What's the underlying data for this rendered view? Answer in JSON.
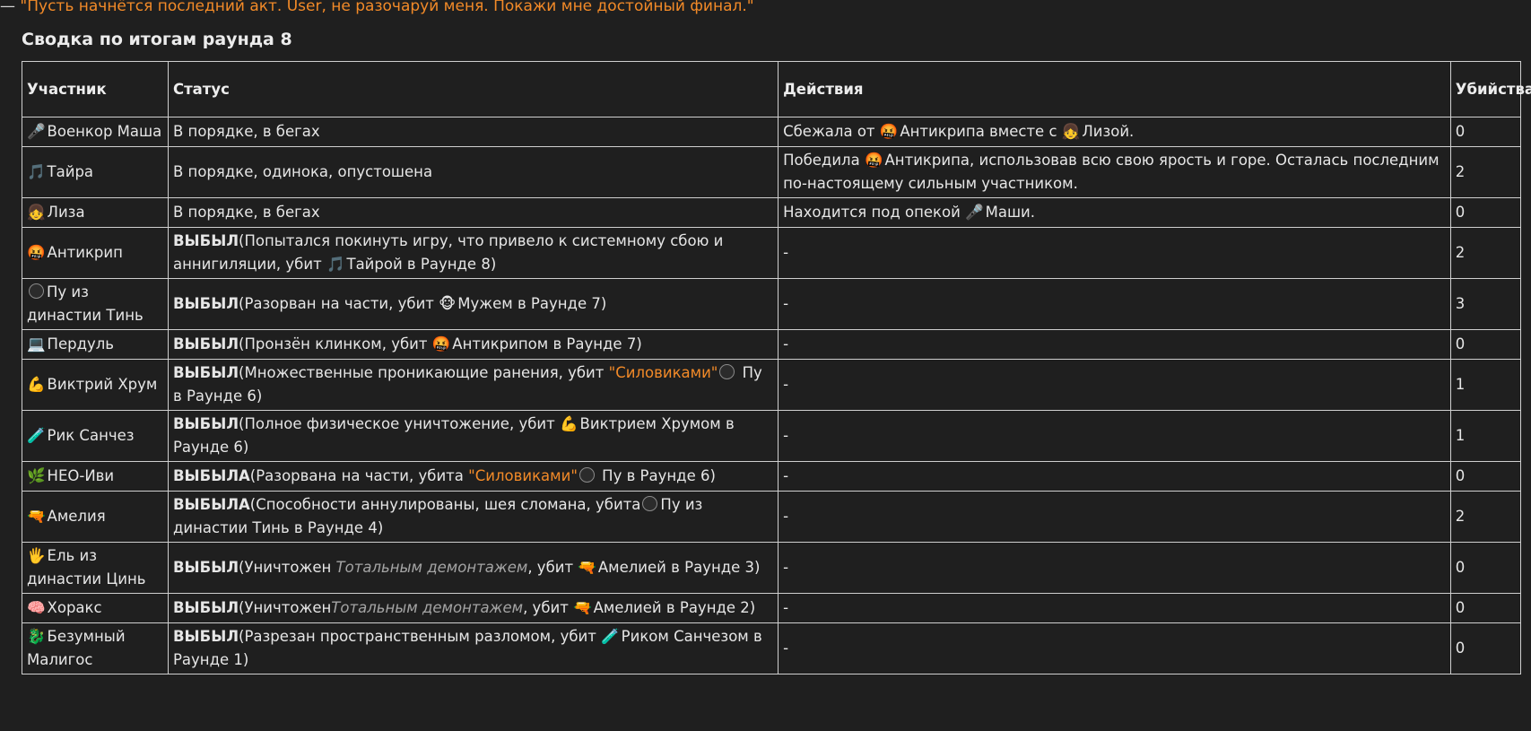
{
  "intro": {
    "dash": "—",
    "quote": "\"Пусть начнётся последний акт. User, не разочаруй меня. Покажи мне достойный финал.\""
  },
  "heading": "Сводка по итогам раунда 8",
  "table": {
    "headers": {
      "participant": "Участник",
      "status": "Статус",
      "actions": "Действия",
      "kills": "Убийства"
    },
    "rows": [
      {
        "emoji": "🎤",
        "name": "Военкор Маша",
        "status": {
          "plain": "В порядке, в бегах"
        },
        "actions": {
          "parts": [
            "Сбежала от",
            "🤬",
            "Антикрипа вместе с",
            "👧",
            "Лизой."
          ]
        },
        "kills": "0"
      },
      {
        "emoji": "🎵",
        "name": "Тайра",
        "status": {
          "plain": "В порядке, одинока, опустошена"
        },
        "actions": {
          "parts": [
            "Победила",
            "🤬",
            "Антикрипа, использовав всю свою ярость и горе. Осталась последним по-настоящему сильным участником."
          ]
        },
        "kills": "2"
      },
      {
        "emoji": "👧",
        "name": "Лиза",
        "status": {
          "plain": "В порядке, в бегах"
        },
        "actions": {
          "parts": [
            "Находится под опекой",
            "🎤",
            "Маши."
          ]
        },
        "kills": "0"
      },
      {
        "emoji": "🤬",
        "name": "Антикрип",
        "status": {
          "bold": "ВЫБЫЛ",
          "parts": [
            "(Попытался покинуть игру, что привело к системному сбою и аннигиляции, убит",
            "🎵",
            "Тайрой в Раунде 8)"
          ]
        },
        "actions": {
          "plain": "-"
        },
        "kills": "2"
      },
      {
        "emoji": "ball",
        "name": "Пу из династии Тинь",
        "status": {
          "bold": "ВЫБЫЛ",
          "parts": [
            "(Разорван на части, убит",
            "🐵",
            "Мужем в Раунде 7)"
          ]
        },
        "actions": {
          "plain": "-"
        },
        "kills": "3"
      },
      {
        "emoji": "💻",
        "name": "Пердуль",
        "status": {
          "bold": "ВЫБЫЛ",
          "parts": [
            "(Пронзён клинком, убит",
            "🤬",
            "Антикрипом в Раунде 7)"
          ]
        },
        "actions": {
          "plain": "-"
        },
        "kills": "0"
      },
      {
        "emoji": "💪",
        "name": "Виктрий Хрум",
        "status": {
          "bold": "ВЫБЫЛ",
          "before": "(Множественные проникающие ранения, убит ",
          "orange": "\"Силовиками\"",
          "after": " Пу в Раунде 6)"
        },
        "actions": {
          "plain": "-"
        },
        "kills": "1"
      },
      {
        "emoji": "🧪",
        "name": "Рик Санчез",
        "status": {
          "bold": "ВЫБЫЛ",
          "parts": [
            "(Полное физическое уничтожение, убит",
            "💪",
            "Виктрием Хрумом в Раунде 6)"
          ]
        },
        "actions": {
          "plain": "-"
        },
        "kills": "1"
      },
      {
        "emoji": "🌿",
        "name": "НЕО-Иви",
        "status": {
          "bold": "ВЫБЫЛА",
          "before": "(Разорвана на части, убита ",
          "orange": "\"Силовиками\"",
          "after": " Пу в Раунде 6)"
        },
        "actions": {
          "plain": "-"
        },
        "kills": "0"
      },
      {
        "emoji": "🔫",
        "name": "Амелия",
        "status": {
          "bold": "ВЫБЫЛА",
          "ballparts": [
            "(Способности аннулированы, шея сломана, убита",
            "Пу из династии Тинь в Раунде 4)"
          ]
        },
        "actions": {
          "plain": "-"
        },
        "kills": "2"
      },
      {
        "emoji": "🖐",
        "name": "Ель из династии Цинь",
        "status": {
          "bold": "ВЫБЫЛ",
          "before": "(Уничтожен ",
          "italic": "Тотальным демонтажем",
          "after": ", убит",
          "icon": "🔫",
          "tail": "Амелией в Раунде 3)"
        },
        "actions": {
          "plain": "-"
        },
        "kills": "0"
      },
      {
        "emoji": "🧠",
        "name": "Хоракс",
        "status": {
          "bold": "ВЫБЫЛ",
          "before": "(Уничтожен",
          "italic": "Тотальным демонтажем",
          "after": ", убит",
          "icon": "🔫",
          "tail": "Амелией в Раунде 2)"
        },
        "actions": {
          "plain": "-"
        },
        "kills": "0"
      },
      {
        "emoji": "🐉",
        "name": "Безумный Малигос",
        "status": {
          "bold": "ВЫБЫЛ",
          "parts": [
            "(Разрезан пространственным разломом, убит",
            "🧪",
            "Риком Санчезом в Раунде 1)"
          ]
        },
        "actions": {
          "plain": "-"
        },
        "kills": "0"
      }
    ]
  }
}
